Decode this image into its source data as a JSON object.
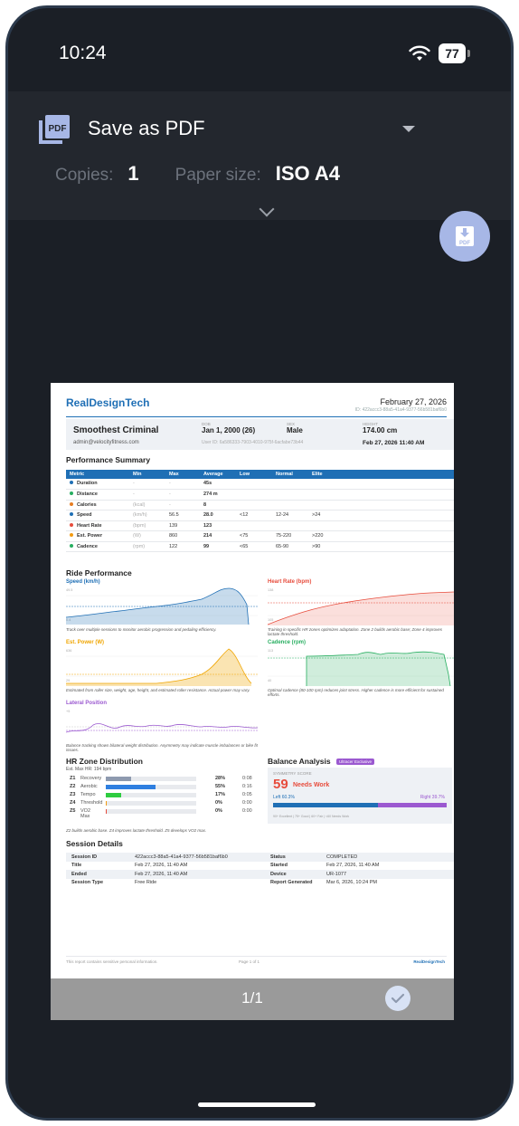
{
  "status_bar": {
    "time": "10:24",
    "battery": "77"
  },
  "print": {
    "destination": "Save as PDF",
    "copies_label": "Copies:",
    "copies": "1",
    "paper_label": "Paper size:",
    "paper": "ISO A4",
    "page_counter": "1/1"
  },
  "report": {
    "brand": "RealDesignTech",
    "date": "February 27, 2026",
    "id_line": "ID: 422accc3-88a5-41a4-9377-56b581baf6b0",
    "rider": {
      "name": "Smoothest Criminal",
      "email": "admin@velocityfitness.com",
      "dob_label": "DOB",
      "dob": "Jan 1, 2000 (26)",
      "sex_label": "SEX",
      "sex": "Male",
      "height_label": "HEIGHT",
      "height": "174.00 cm",
      "user_id": "User ID: 6a586333-7903-4010-975f-6acfabe73b44",
      "generated": "Feb 27, 2026 11:40 AM"
    },
    "perf_title": "Performance Summary",
    "perf_headers": [
      "Metric",
      "Min",
      "Max",
      "Average",
      "Low",
      "Normal",
      "Elite"
    ],
    "perf_rows": [
      {
        "metric": "Duration",
        "unit": "",
        "min": "-",
        "max": "-",
        "avg": "45s",
        "low": "",
        "normal": "",
        "elite": "",
        "color": "#1f6fb5"
      },
      {
        "metric": "Distance",
        "unit": "",
        "min": "-",
        "max": "-",
        "avg": "274 m",
        "low": "",
        "normal": "",
        "elite": "",
        "color": "#27ae60"
      },
      {
        "metric": "Calories",
        "unit": "(kcal)",
        "min": "-",
        "max": "-",
        "avg": "8",
        "low": "",
        "normal": "",
        "elite": "",
        "color": "#e67e22"
      },
      {
        "metric": "Speed",
        "unit": "(km/h)",
        "min": "",
        "max": "56.5",
        "avg": "28.0",
        "low": "<12",
        "normal": "12-24",
        "elite": ">24",
        "color": "#1f6fb5"
      },
      {
        "metric": "Heart Rate",
        "unit": "(bpm)",
        "min": "",
        "max": "139",
        "avg": "123",
        "low": "",
        "normal": "",
        "elite": "",
        "color": "#e74c3c"
      },
      {
        "metric": "Est. Power",
        "unit": "(W)",
        "min": "",
        "max": "860",
        "avg": "214",
        "low": "<75",
        "normal": "75-220",
        "elite": ">220",
        "color": "#f39c12"
      },
      {
        "metric": "Cadence",
        "unit": "(rpm)",
        "min": "",
        "max": "122",
        "avg": "99",
        "low": "<65",
        "normal": "65-90",
        "elite": ">90",
        "color": "#27ae60"
      }
    ],
    "ride_title": "Ride Performance",
    "charts": {
      "speed": {
        "title": "Speed (km/h)",
        "top_tick": "49.5",
        "bottom_tick": "0.4",
        "caption": "Track over multiple sessions to monitor aerobic progression and pedaling efficiency.",
        "color": "#1f6fb5"
      },
      "hr": {
        "title": "Heart Rate (bpm)",
        "top_tick": "138",
        "bottom_tick": "105",
        "caption": "Training in specific HR zones optimizes adaptation. Zone 2 builds aerobic base; Zone 4 improves lactate threshold.",
        "color": "#e74c3c"
      },
      "power": {
        "title": "Est. Power (W)",
        "top_tick": "636",
        "bottom_tick": "29",
        "caption": "Estimated from roller size, weight, age, height, and estimated roller resistance. Actual power may vary.",
        "color": "#f0a500"
      },
      "cadence": {
        "title": "Cadence (rpm)",
        "top_tick": "113",
        "bottom_tick": "40",
        "caption": "Optimal cadence (80-100 rpm) reduces joint stress. Higher cadence is more efficient for sustained efforts.",
        "color": "#27ae60"
      },
      "lateral": {
        "title": "Lateral Position",
        "top_tick": "+5",
        "caption": "Balance tracking shows bilateral weight distribution. Asymmetry may indicate muscle imbalances or bike fit issues.",
        "color": "#9b59d0"
      }
    },
    "hr_zone": {
      "title": "HR Zone Distribution",
      "subtitle": "Est. Max HR: 194 bpm",
      "zones": [
        {
          "id": "Z1",
          "name": "Recovery",
          "pct": "28%",
          "time": "0:08",
          "fill": 0.28,
          "color": "#8e9aaf"
        },
        {
          "id": "Z2",
          "name": "Aerobic",
          "pct": "55%",
          "time": "0:16",
          "fill": 0.55,
          "color": "#2f7fe0"
        },
        {
          "id": "Z3",
          "name": "Tempo",
          "pct": "17%",
          "time": "0:05",
          "fill": 0.17,
          "color": "#2ecc40"
        },
        {
          "id": "Z4",
          "name": "Threshold",
          "pct": "0%",
          "time": "0:00",
          "fill": 0.0,
          "color": "#f39c12"
        },
        {
          "id": "Z5",
          "name": "VO2 Max",
          "pct": "0%",
          "time": "0:00",
          "fill": 0.0,
          "color": "#e74c3c"
        }
      ],
      "caption": "Z2 builds aerobic base. Z4 improves lactate threshold. Z5 develops VO2 max."
    },
    "balance": {
      "title": "Balance Analysis",
      "badge": "Ultracer Exclusive",
      "score_label": "SYMMETRY SCORE",
      "score": "59",
      "verdict": "Needs Work",
      "left": "Left 60.3%",
      "right": "Right 39.7%",
      "left_fraction": 0.603,
      "legend": "90+ Excellent | 75+ Good | 60+ Fair | <60 Needs Work"
    },
    "session": {
      "title": "Session Details",
      "rows": [
        {
          "k1": "Session ID",
          "v1": "422accc3-88a5-41a4-9377-56b581baf6b0",
          "k2": "Status",
          "v2": "COMPLETED"
        },
        {
          "k1": "Title",
          "v1": "Feb 27, 2026, 11:40 AM",
          "k2": "Started",
          "v2": "Feb 27, 2026, 11:40 AM"
        },
        {
          "k1": "Ended",
          "v1": "Feb 27, 2026, 11:40 AM",
          "k2": "Device",
          "v2": "UR-1077"
        },
        {
          "k1": "Session Type",
          "v1": "Free Ride",
          "k2": "Report Generated",
          "v2": "Mar 6, 2026, 10:24 PM"
        }
      ]
    },
    "footer": {
      "note": "This report contains sensitive personal information.",
      "page": "Page 1 of 1",
      "brand": "RealDesignTech"
    }
  }
}
